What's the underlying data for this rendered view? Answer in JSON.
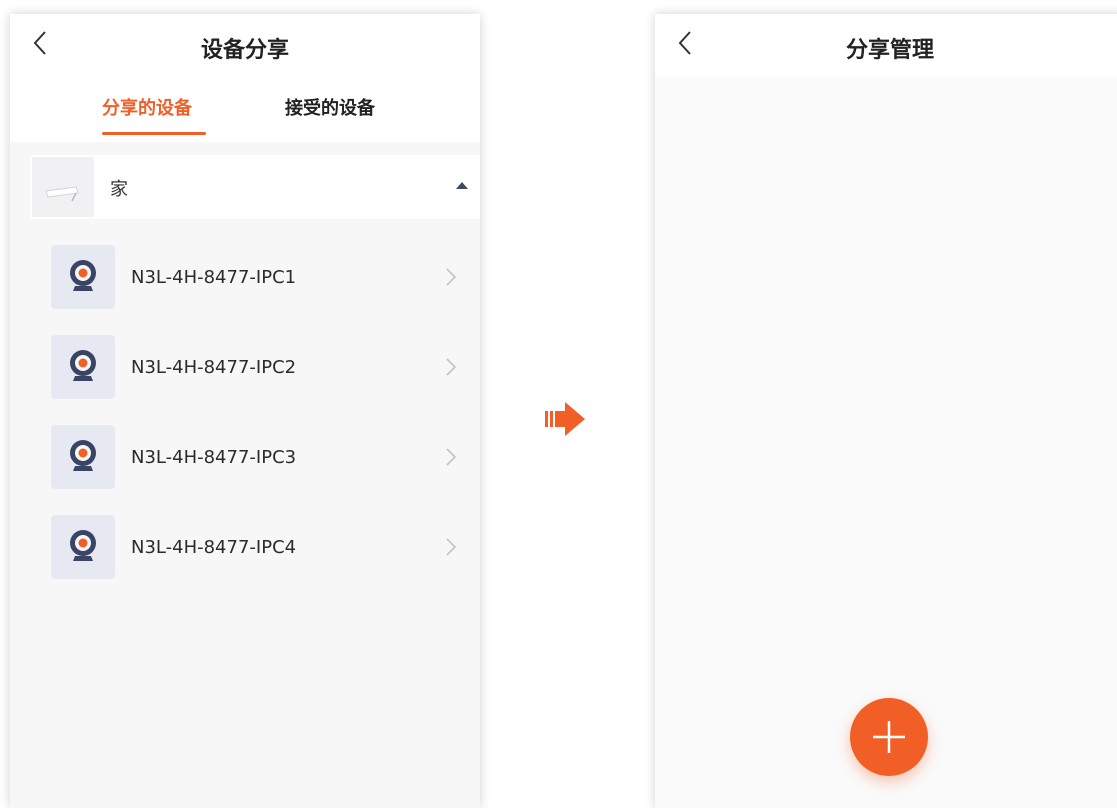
{
  "left_screen": {
    "title": "设备分享",
    "tabs": [
      {
        "label": "分享的设备",
        "active": true
      },
      {
        "label": "接受的设备",
        "active": false
      }
    ],
    "group": {
      "label": "家",
      "expanded": true
    },
    "devices": [
      {
        "name": "N3L-4H-8477-IPC1"
      },
      {
        "name": "N3L-4H-8477-IPC2"
      },
      {
        "name": "N3L-4H-8477-IPC3"
      },
      {
        "name": "N3L-4H-8477-IPC4"
      }
    ]
  },
  "right_screen": {
    "title": "分享管理"
  },
  "icons": {
    "back": "chevron-left-icon",
    "expand": "caret-up-icon",
    "device": "camera-icon",
    "row_chevron": "chevron-right-icon",
    "transition": "arrow-right-icon",
    "add": "plus-icon"
  },
  "colors": {
    "accent": "#f25f26",
    "caret": "#3d4a66",
    "device_icon_bg": "#e7e9f2"
  }
}
